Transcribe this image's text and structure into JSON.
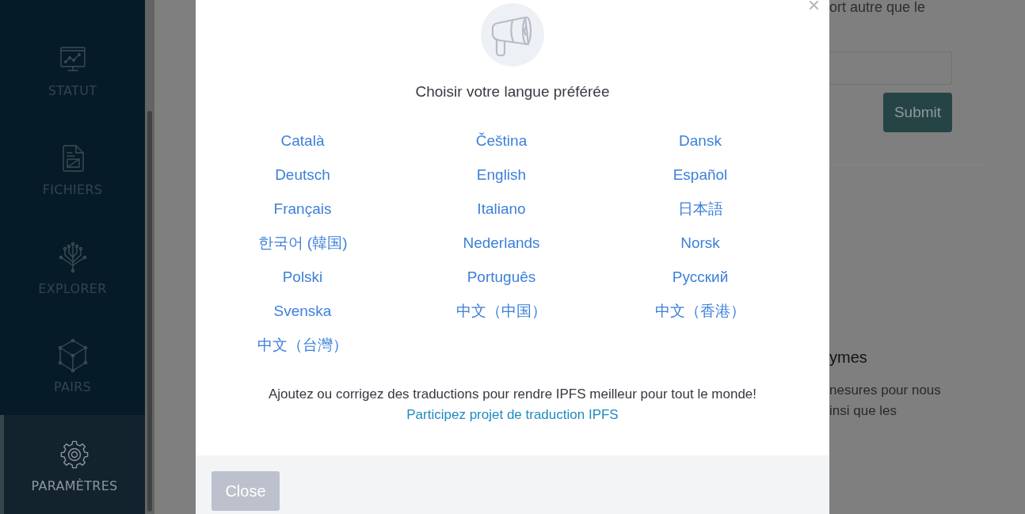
{
  "sidebar": {
    "items": [
      {
        "label": "STATUT",
        "selected": false
      },
      {
        "label": "FICHIERS",
        "selected": false
      },
      {
        "label": "EXPLORER",
        "selected": false
      },
      {
        "label": "PAIRS",
        "selected": false
      },
      {
        "label": "PARAMÈTRES",
        "selected": true
      }
    ]
  },
  "settings_page": {
    "partial_text": "ort autre que le",
    "submit_button": "Submit",
    "section_heading": "ymes",
    "section_text_lines": [
      "nesures pour nous",
      "insi que les"
    ]
  },
  "language_dialog": {
    "title": "Choisir votre langue préférée",
    "languages": [
      "Català",
      "Čeština",
      "Dansk",
      "Deutsch",
      "English",
      "Español",
      "Français",
      "Italiano",
      "日本語",
      "한국어 (韓国)",
      "Nederlands",
      "Norsk",
      "Polski",
      "Português",
      "Русский",
      "Svenska",
      "中文（中国）",
      "中文（香港）",
      "中文（台灣）"
    ],
    "help_text": "Ajoutez ou corrigez des traductions pour rendre IPFS meilleur pour tout le monde!",
    "project_link": "Participez projet de traduction IPFS",
    "close_button": "Close"
  }
}
